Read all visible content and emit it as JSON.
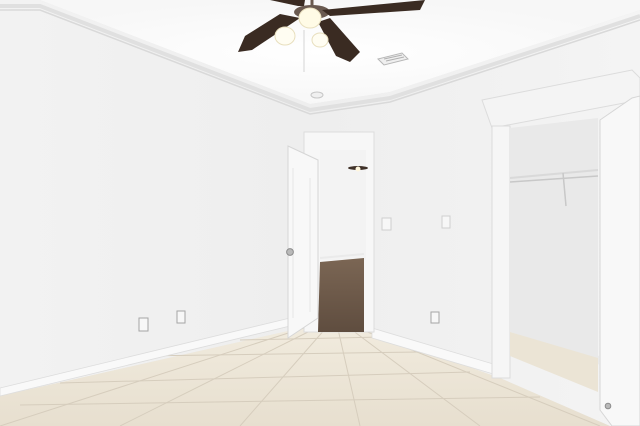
{
  "scene": {
    "description_kind": "photo",
    "room": "empty bedroom",
    "colors": {
      "wall_left": "#f4f4f4",
      "wall_back": "#efefef",
      "ceiling": "#f7f7f7",
      "floor_tile": "#ece6d7",
      "grout": "#d7cfbf",
      "door": "#f8f8f8",
      "hall_floor": "#6f5a48",
      "fan_blade": "#3a2b22",
      "light": "#fffbe6"
    },
    "objects": [
      "ceiling-fan",
      "air-vent",
      "smoke-detector",
      "open-interior-door",
      "hallway",
      "closet-opening",
      "closet-rod-shelf",
      "closet-door",
      "light-switches",
      "electrical-outlets",
      "baseboards",
      "crown-molding",
      "tile-floor"
    ]
  }
}
